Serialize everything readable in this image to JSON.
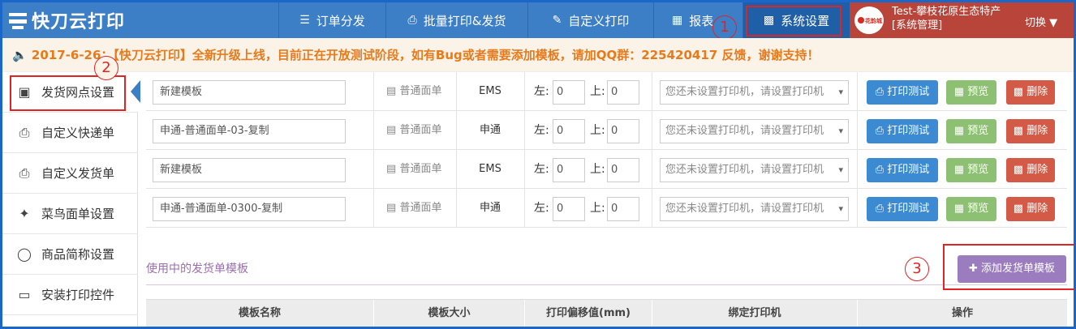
{
  "app": {
    "title": "快刀云打印"
  },
  "nav": {
    "items": [
      {
        "label": "订单分发",
        "icon": "layers-icon"
      },
      {
        "label": "批量打印&发货",
        "icon": "printer-icon"
      },
      {
        "label": "自定义打印",
        "icon": "pencil-icon"
      },
      {
        "label": "报表",
        "icon": "calendar-icon"
      },
      {
        "label": "系统设置",
        "icon": "grid-icon"
      }
    ]
  },
  "user": {
    "name": "Test-攀枝花原生态特产",
    "role": "[系统管理]",
    "switch_label": "切换",
    "avatar_text": "花韵城"
  },
  "notice": {
    "text": "2017-6-26：【快刀云打印】全新升级上线，目前正在开放测试阶段，如有Bug或者需要添加模板，请加QQ群：225420417 反馈，谢谢支持！"
  },
  "annotations": {
    "n1": "1",
    "n2": "2",
    "n3": "3"
  },
  "sidebar": {
    "items": [
      {
        "label": "发货网点设置",
        "icon": "store-icon"
      },
      {
        "label": "自定义快递单",
        "icon": "printer-icon"
      },
      {
        "label": "自定义发货单",
        "icon": "print-doc-icon"
      },
      {
        "label": "菜鸟面单设置",
        "icon": "bird-icon"
      },
      {
        "label": "商品简称设置",
        "icon": "chat-bubble-icon"
      },
      {
        "label": "安装打印控件",
        "icon": "monitor-download-icon"
      }
    ]
  },
  "templates": {
    "offset_left_label": "左:",
    "offset_top_label": "上:",
    "rows": [
      {
        "name": "新建模板",
        "size": "普通面单",
        "courier": "EMS",
        "left": "0",
        "top": "0",
        "printer_placeholder": "您还未设置打印机，请设置打印机"
      },
      {
        "name": "申通-普通面单-03-复制",
        "size": "普通面单",
        "courier": "申通",
        "left": "0",
        "top": "0",
        "printer_placeholder": "您还未设置打印机，请设置打印机"
      },
      {
        "name": "新建模板",
        "size": "普通面单",
        "courier": "EMS",
        "left": "0",
        "top": "0",
        "printer_placeholder": "您还未设置打印机，请设置打印机"
      },
      {
        "name": "申通-普通面单-0300-复制",
        "size": "普通面单",
        "courier": "申通",
        "left": "0",
        "top": "0",
        "printer_placeholder": "您还未设置打印机，请设置打印机"
      }
    ],
    "btn_test": "打印测试",
    "btn_preview": "预览",
    "btn_delete": "删除"
  },
  "section": {
    "title": "使用中的发货单模板",
    "add_button": "添加发货单模板",
    "columns": [
      "模板名称",
      "模板大小",
      "打印偏移值(mm)",
      "绑定打印机",
      "操作"
    ]
  },
  "colors": {
    "topbar": "#3c7fc6",
    "user_bg": "#b8443a",
    "notice_text": "#e87a1b",
    "highlight": "#e02424",
    "add_button": "#9a7cbf"
  }
}
